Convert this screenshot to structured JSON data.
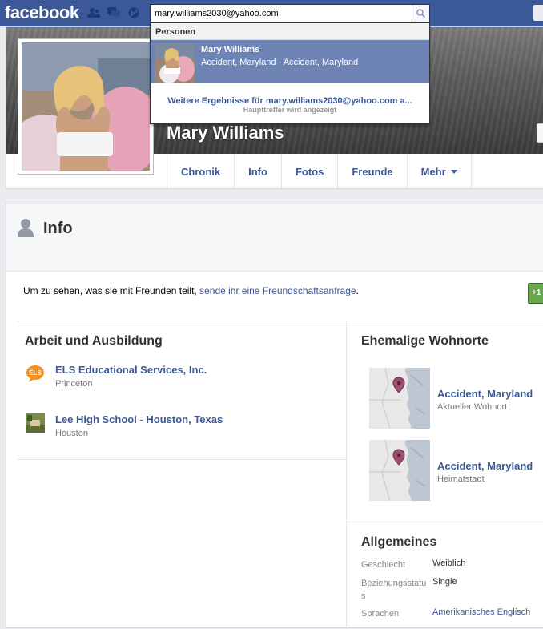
{
  "topbar": {
    "logo": "facebook",
    "search_value": "mary.williams2030@yahoo.com"
  },
  "search_dropdown": {
    "header": "Personen",
    "result": {
      "name": "Mary Williams",
      "subtitle": "Accident, Maryland · Accident, Maryland"
    },
    "more_results": "Weitere Ergebnisse für mary.williams2030@yahoo.com a...",
    "more_sub": "Haupttreffer wird angezeigt"
  },
  "profile": {
    "name": "Mary Williams",
    "tabs": [
      "Chronik",
      "Info",
      "Fotos",
      "Freunde",
      "Mehr"
    ]
  },
  "info": {
    "title": "Info",
    "friend_text": "Um zu sehen, was sie mit Freunden teilt, ",
    "friend_link": "sende ihr eine Freundschaftsanfrage",
    "friend_end": ".",
    "work_title": "Arbeit und Ausbildung",
    "work": [
      {
        "name": "ELS Educational Services, Inc.",
        "place": "Princeton",
        "icon": "ELS"
      },
      {
        "name": "Lee High School - Houston, Texas",
        "place": "Houston"
      }
    ],
    "places_title": "Ehemalige Wohnorte",
    "places": [
      {
        "name": "Accident, Maryland",
        "sub": "Aktueller Wohnort"
      },
      {
        "name": "Accident, Maryland",
        "sub": "Heimatstadt"
      }
    ],
    "general_title": "Allgemeines",
    "general": [
      {
        "label": "Geschlecht",
        "value": "Weiblich"
      },
      {
        "label": "Beziehungsstatus",
        "value": "Single"
      },
      {
        "label": "Sprachen",
        "value": "Amerikanisches Englisch"
      }
    ]
  },
  "colors": {
    "brand": "#3b5998",
    "highlight": "#6d84b4",
    "background": "#e9ebee",
    "add_friend": "#69a74e"
  }
}
